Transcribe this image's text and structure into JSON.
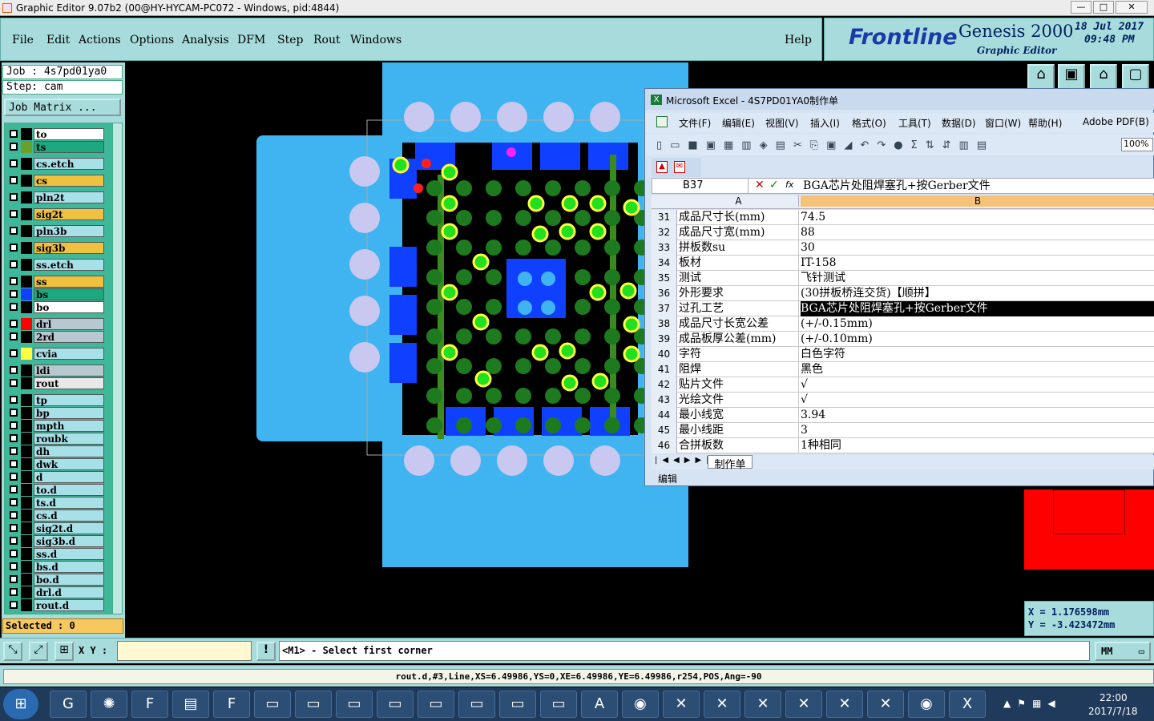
{
  "window": {
    "title": "Graphic Editor 9.07b2 (00@HY-HYCAM-PC072 - Windows, pid:4844)",
    "min": "—",
    "max": "□",
    "close": "✕"
  },
  "menu": [
    "File",
    "Edit",
    "Actions",
    "Options",
    "Analysis",
    "DFM",
    "Step",
    "Rout",
    "Windows"
  ],
  "help": "Help",
  "logo": {
    "brand": "Frontline",
    "product": "Genesis 2000",
    "sub": "Graphic Editor",
    "date": "18 Jul 2017",
    "time": "09:48 PM"
  },
  "job": {
    "label": "Job : 4s7pd01ya0",
    "step": "Step: cam",
    "matrix": "Job Matrix ..."
  },
  "layers": [
    {
      "name": "to",
      "color": "#ffffff",
      "sw": ""
    },
    {
      "name": "ts",
      "color": "#1ea880",
      "sw": "#6aa02a"
    },
    {
      "name": "cs.etch",
      "color": "#a8e0e8",
      "sw": ""
    },
    {
      "name": "cs",
      "color": "#f0c040",
      "sw": ""
    },
    {
      "name": "pln2t",
      "color": "#a8e0e8",
      "sw": ""
    },
    {
      "name": "sig2t",
      "color": "#f0c040",
      "sw": ""
    },
    {
      "name": "pln3b",
      "color": "#a8e0e8",
      "sw": ""
    },
    {
      "name": "sig3b",
      "color": "#f0c040",
      "sw": ""
    },
    {
      "name": "ss.etch",
      "color": "#a8e0e8",
      "sw": ""
    },
    {
      "name": "ss",
      "color": "#f0c040",
      "sw": ""
    },
    {
      "name": "bs",
      "color": "#1ea880",
      "sw": "#1040ff"
    },
    {
      "name": "bo",
      "color": "#ffffff",
      "sw": ""
    },
    {
      "name": "drl",
      "color": "#b8c8d0",
      "sw": "#ff0000"
    },
    {
      "name": "2rd",
      "color": "#b8c8d0",
      "sw": ""
    },
    {
      "name": "cvia",
      "color": "#a8e0e8",
      "sw": "#ffff40"
    },
    {
      "name": "ldi",
      "color": "#b8c8d0",
      "sw": ""
    },
    {
      "name": "rout",
      "color": "#e8e8e8",
      "sw": ""
    },
    {
      "name": "tp",
      "color": "#a8e0e8",
      "sw": ""
    },
    {
      "name": "bp",
      "color": "#a8e0e8",
      "sw": ""
    },
    {
      "name": "mpth",
      "color": "#a8e0e8",
      "sw": ""
    },
    {
      "name": "roubk",
      "color": "#a8e0e8",
      "sw": ""
    },
    {
      "name": "dh",
      "color": "#a8e0e8",
      "sw": ""
    },
    {
      "name": "dwk",
      "color": "#a8e0e8",
      "sw": ""
    },
    {
      "name": "d",
      "color": "#a8e0e8",
      "sw": ""
    },
    {
      "name": "to.d",
      "color": "#a8e0e8",
      "sw": ""
    },
    {
      "name": "ts.d",
      "color": "#a8e0e8",
      "sw": ""
    },
    {
      "name": "cs.d",
      "color": "#a8e0e8",
      "sw": ""
    },
    {
      "name": "sig2t.d",
      "color": "#a8e0e8",
      "sw": ""
    },
    {
      "name": "sig3b.d",
      "color": "#a8e0e8",
      "sw": ""
    },
    {
      "name": "ss.d",
      "color": "#a8e0e8",
      "sw": ""
    },
    {
      "name": "bs.d",
      "color": "#a8e0e8",
      "sw": ""
    },
    {
      "name": "bo.d",
      "color": "#a8e0e8",
      "sw": ""
    },
    {
      "name": "drl.d",
      "color": "#a8e0e8",
      "sw": ""
    },
    {
      "name": "rout.d",
      "color": "#a8e0e8",
      "sw": ""
    }
  ],
  "selected": "Selected : 0",
  "coords": {
    "x": "X  =  1.176598mm",
    "y": "Y  = -3.423472mm"
  },
  "cmd": {
    "xy_label": "X Y :",
    "prompt": "<M1> - Select first corner",
    "unit": "MM"
  },
  "status": "rout.d,#3,Line,XS=6.49986,YS=0,XE=6.49986,YE=6.49986,r254,POS,Ang=-90",
  "excel": {
    "title": "Microsoft Excel - 4S7PD01YA0制作单",
    "menus": [
      "文件(F)",
      "编辑(E)",
      "视图(V)",
      "插入(I)",
      "格式(O)",
      "工具(T)",
      "数据(D)",
      "窗口(W)",
      "帮助(H)",
      "Adobe PDF(B)"
    ],
    "zoom": "100%",
    "namebox": "B37",
    "fx": "fx",
    "formula": "BGA芯片处阻焊塞孔+按Gerber文件",
    "colA": "A",
    "colB": "B",
    "rows": [
      {
        "n": "31",
        "a": "成品尺寸长(mm)",
        "b": "74.5"
      },
      {
        "n": "32",
        "a": "成品尺寸宽(mm)",
        "b": "88"
      },
      {
        "n": "33",
        "a": "拼板数su",
        "b": "30"
      },
      {
        "n": "34",
        "a": "板材",
        "b": "IT-158"
      },
      {
        "n": "35",
        "a": "测试",
        "b": "飞针测试"
      },
      {
        "n": "36",
        "a": "外形要求",
        "b": "(30拼板桥连交货)【顺拼】"
      },
      {
        "n": "37",
        "a": "过孔工艺",
        "b": "BGA芯片处阻焊塞孔+按Gerber文件"
      },
      {
        "n": "38",
        "a": "成品尺寸长宽公差",
        "b": "(+/-0.15mm)"
      },
      {
        "n": "39",
        "a": "成品板厚公差(mm)",
        "b": "(+/-0.10mm)"
      },
      {
        "n": "40",
        "a": "字符",
        "b": "白色字符"
      },
      {
        "n": "41",
        "a": "阻焊",
        "b": "黑色"
      },
      {
        "n": "42",
        "a": "贴片文件",
        "b": "√"
      },
      {
        "n": "43",
        "a": "光绘文件",
        "b": "√"
      },
      {
        "n": "44",
        "a": "最小线宽",
        "b": "3.94"
      },
      {
        "n": "45",
        "a": "最小线距",
        "b": "3"
      },
      {
        "n": "46",
        "a": "合拼板数",
        "b": "1种相同"
      }
    ],
    "sheet": "制作单",
    "statusbar": "编辑"
  },
  "clock": {
    "time": "22:00",
    "date": "2017/7/18"
  }
}
